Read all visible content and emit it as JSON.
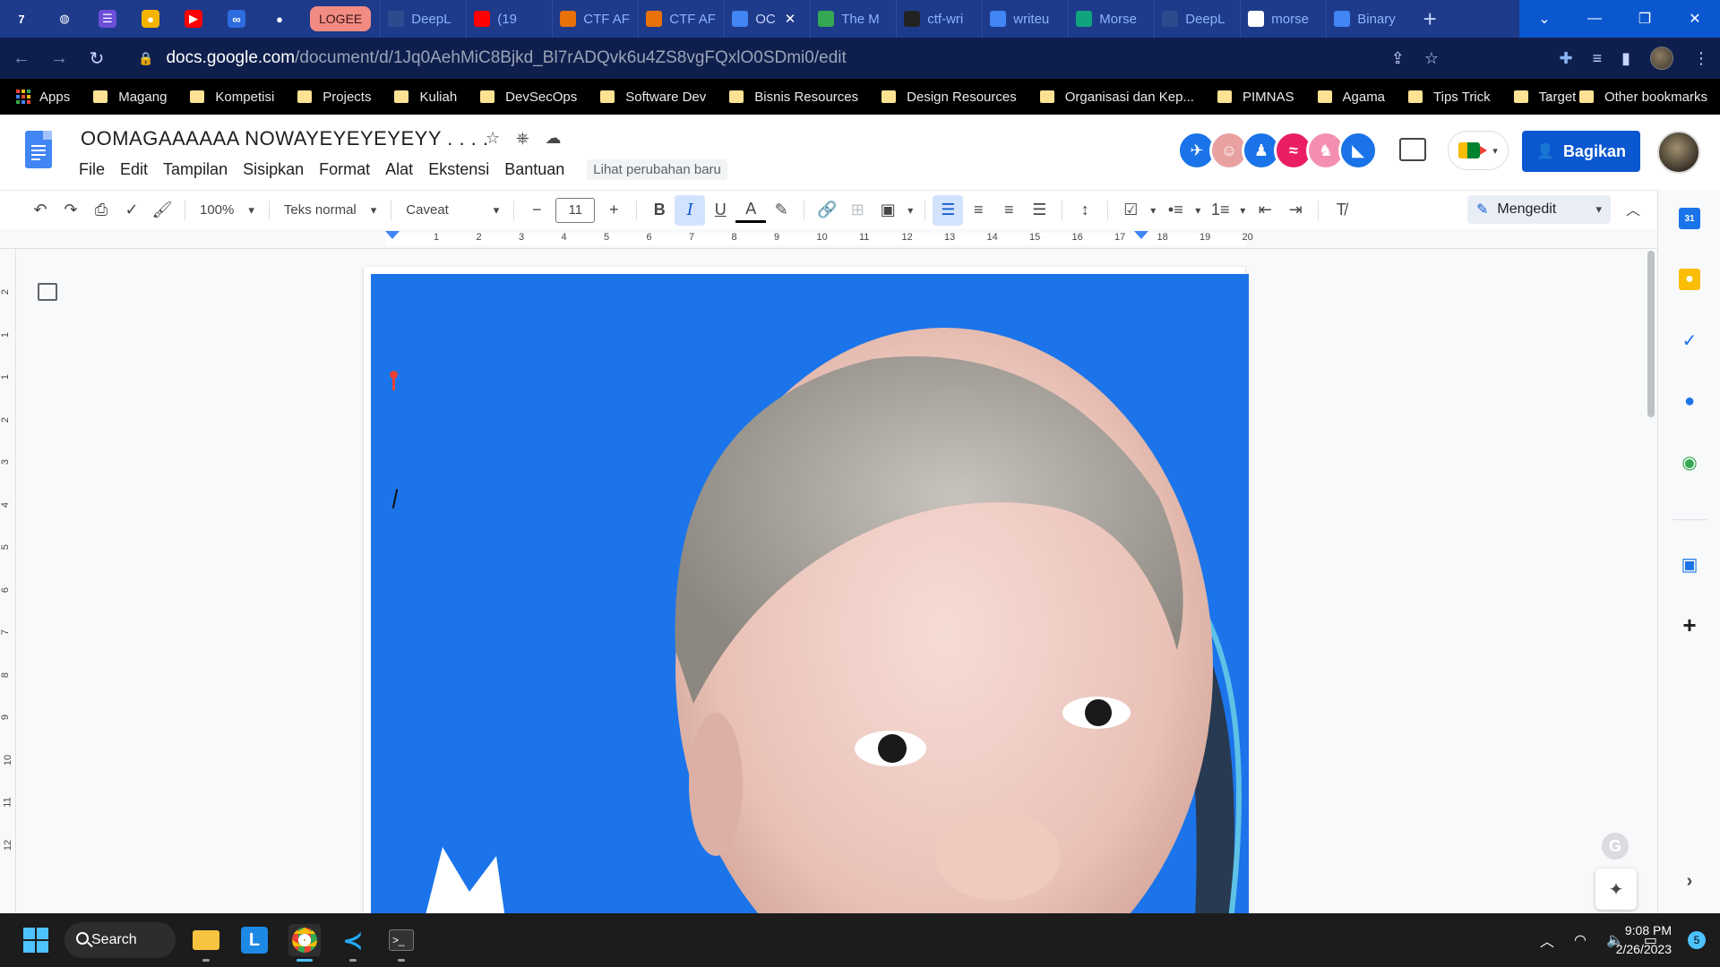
{
  "browser": {
    "pinned_tabs": [
      {
        "icon": "ctfd-icon",
        "glyph": "7",
        "color": "#1e3a8a"
      },
      {
        "icon": "globe-icon",
        "glyph": "◍",
        "color": "#1e3a8a"
      },
      {
        "icon": "list-app-icon",
        "glyph": "☰",
        "color": "#6b4fd8"
      },
      {
        "icon": "keep-icon",
        "glyph": "●",
        "color": "#f6b400"
      },
      {
        "icon": "youtube-icon",
        "glyph": "▶",
        "color": "#ff0000"
      },
      {
        "icon": "meta-icon",
        "glyph": "∞",
        "color": "#2d6cdf"
      },
      {
        "icon": "github-icon",
        "glyph": "●",
        "color": "#1e3a8a"
      }
    ],
    "tab_group_label": "LOGEE",
    "tabs": [
      {
        "title": "DeepL",
        "icon": "deepl-icon",
        "color": "#2c4b8f"
      },
      {
        "title": "(19",
        "icon": "youtube-icon",
        "color": "#ff0000"
      },
      {
        "title": "CTF AF",
        "icon": "ctf-icon",
        "color": "#e8710a"
      },
      {
        "title": "CTF AF",
        "icon": "ctf-icon",
        "color": "#e8710a"
      },
      {
        "title": "OC",
        "icon": "docs-icon",
        "color": "#4285f4"
      },
      {
        "title": "The M",
        "icon": "drive-icon",
        "color": "#34a853"
      },
      {
        "title": "ctf-wri",
        "icon": "github-icon",
        "color": "#222"
      },
      {
        "title": "writeu",
        "icon": "docs-icon",
        "color": "#4285f4"
      },
      {
        "title": "Morse",
        "icon": "chatgpt-icon",
        "color": "#10a37f"
      },
      {
        "title": "DeepL",
        "icon": "deepl-icon",
        "color": "#2c4b8f"
      },
      {
        "title": "morse",
        "icon": "google-icon",
        "color": "#ffffff"
      },
      {
        "title": "Binary",
        "icon": "binary-icon",
        "color": "#4285f4"
      }
    ],
    "url_host": "docs.google.com",
    "url_path": "/document/d/1Jq0AehMiC8Bjkd_Bl7rADQvk6u4ZS8vgFQxlO0SDmi0/edit",
    "bookmarks": [
      "Apps",
      "Magang",
      "Kompetisi",
      "Projects",
      "Kuliah",
      "DevSecOps",
      "Software Dev",
      "Bisnis Resources",
      "Design Resources",
      "Organisasi dan Kep...",
      "PIMNAS",
      "Agama",
      "Tips Trick",
      "Target"
    ],
    "bookmarks_overflow": "»",
    "other_bookmarks": "Other bookmarks"
  },
  "doc": {
    "title": "OOMAGAAAAAA NOWAYEYEYEYEYY . . . .",
    "menu": [
      "File",
      "Edit",
      "Tampilan",
      "Sisipkan",
      "Format",
      "Alat",
      "Ekstensi",
      "Bantuan"
    ],
    "changes_label": "Lihat perubahan baru",
    "share_label": "Bagikan",
    "collaborators": [
      {
        "icon": "anonymous-bird-avatar",
        "color": "#1a73e8",
        "glyph": "✈"
      },
      {
        "icon": "anonymous-ghost-avatar",
        "color": "#e8a0a0",
        "glyph": "☺"
      },
      {
        "icon": "anonymous-penguin-avatar",
        "color": "#1a73e8",
        "glyph": "♟"
      },
      {
        "icon": "anonymous-turtle-avatar",
        "color": "#e91e63",
        "glyph": "≈"
      },
      {
        "icon": "anonymous-capybara-avatar",
        "color": "#f48fb1",
        "glyph": "♞"
      },
      {
        "icon": "anonymous-dolphin-avatar",
        "color": "#1a73e8",
        "glyph": "◣"
      }
    ]
  },
  "toolbar": {
    "zoom": "100%",
    "style": "Teks normal",
    "font": "Caveat",
    "font_size": "11",
    "minus": "−",
    "plus": "+",
    "mode": "Mengedit"
  },
  "ruler": {
    "h_numbers": [
      "1",
      "2",
      "3",
      "4",
      "5",
      "6",
      "7",
      "8",
      "9",
      "10",
      "11",
      "12",
      "13",
      "14",
      "15",
      "16",
      "17",
      "18",
      "19",
      "20"
    ],
    "v_numbers": [
      "2",
      "1",
      "1",
      "2",
      "3",
      "4",
      "5",
      "6",
      "7",
      "8",
      "9",
      "10",
      "11",
      "12"
    ]
  },
  "taskbar": {
    "search_label": "Search",
    "time": "9:08 PM",
    "date": "2/26/2023",
    "notifications": "5"
  }
}
